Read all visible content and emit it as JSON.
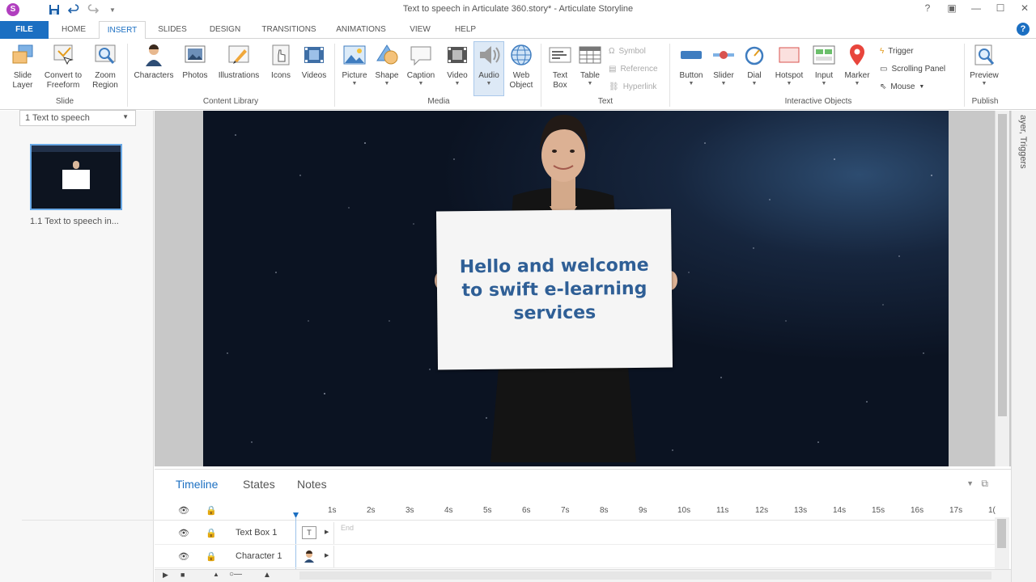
{
  "window": {
    "title": "Text to speech in Articulate 360.story* - Articulate Storyline"
  },
  "tabs": [
    "FILE",
    "HOME",
    "INSERT",
    "SLIDES",
    "DESIGN",
    "TRANSITIONS",
    "ANIMATIONS",
    "VIEW",
    "HELP"
  ],
  "active_tab": "INSERT",
  "ribbon": {
    "groups": {
      "slide": "Slide",
      "content_library": "Content Library",
      "media": "Media",
      "text": "Text",
      "interactive_objects": "Interactive Objects",
      "publish": "Publish"
    },
    "buttons": {
      "slide_layer_1": "Slide",
      "slide_layer_2": "Layer",
      "convert_freeform_1": "Convert to",
      "convert_freeform_2": "Freeform",
      "zoom_region_1": "Zoom",
      "zoom_region_2": "Region",
      "characters": "Characters",
      "photos": "Photos",
      "illustrations": "Illustrations",
      "icons": "Icons",
      "videos": "Videos",
      "picture": "Picture",
      "shape": "Shape",
      "caption": "Caption",
      "video": "Video",
      "audio": "Audio",
      "web_object_1": "Web",
      "web_object_2": "Object",
      "text_box_1": "Text",
      "text_box_2": "Box",
      "table": "Table",
      "symbol": "Symbol",
      "reference": "Reference",
      "hyperlink": "Hyperlink",
      "button": "Button",
      "slider": "Slider",
      "dial": "Dial",
      "hotspot": "Hotspot",
      "input": "Input",
      "marker": "Marker",
      "trigger": "Trigger",
      "scrolling_panel": "Scrolling Panel",
      "mouse": "Mouse",
      "preview": "Preview"
    }
  },
  "left_panel": {
    "scene_select": "1 Text to speech",
    "slide_thumb_label": "1.1 Text to speech in..."
  },
  "slide": {
    "board_text_line1": "Hello and welcome",
    "board_text_line2": "to swift e-learning",
    "board_text_line3": "services"
  },
  "right_panel": {
    "vertical_text": "ayer, Triggers"
  },
  "timeline": {
    "tabs": [
      "Timeline",
      "States",
      "Notes"
    ],
    "ruler": [
      "1s",
      "2s",
      "3s",
      "4s",
      "5s",
      "6s",
      "7s",
      "8s",
      "9s",
      "10s",
      "11s",
      "12s",
      "13s",
      "14s",
      "15s",
      "16s",
      "17s",
      "1("
    ],
    "rows": [
      {
        "name": "Text Box 1"
      },
      {
        "name": "Character 1"
      }
    ],
    "end_label": "End"
  }
}
